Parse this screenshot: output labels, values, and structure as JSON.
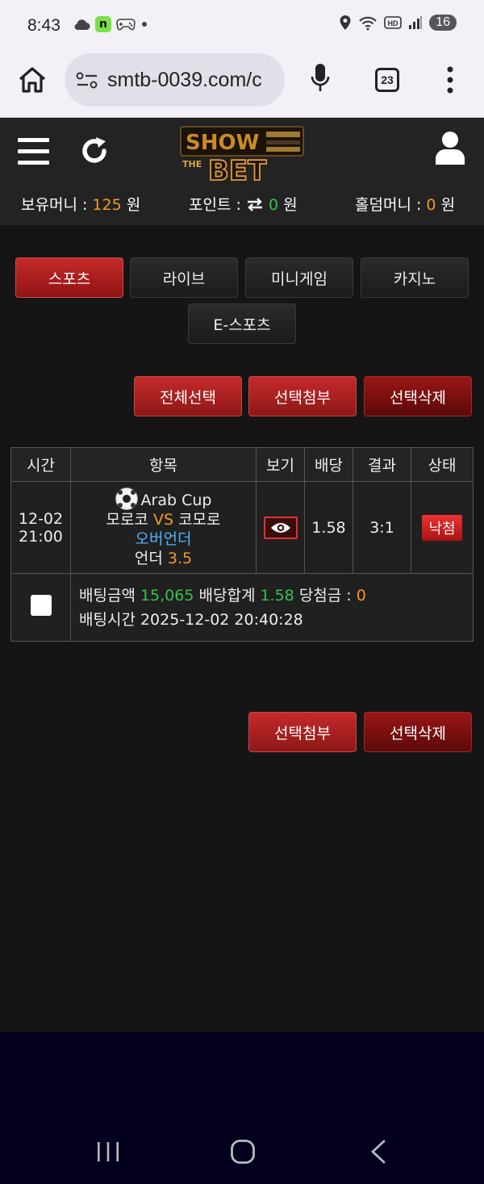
{
  "status_bar": {
    "time": "8:43",
    "notification_count": "16",
    "icons": [
      "cloud-icon",
      "n-app-icon",
      "gamepad-icon",
      "dot-icon",
      "location-icon",
      "wifi-icon",
      "hd-icon",
      "signal-icon"
    ]
  },
  "browser": {
    "url": "smtb-0039.com/c",
    "tab_count": "23"
  },
  "header": {
    "logo_top": "SHOW",
    "logo_mid": "THE",
    "logo_bottom": "BET"
  },
  "wallet": {
    "money_label": "보유머니 :",
    "money_value": "125",
    "money_unit": "원",
    "point_label": "포인트 :",
    "point_value": "0",
    "point_unit": "원",
    "hold_label": "홀덤머니 :",
    "hold_value": "0",
    "hold_unit": "원"
  },
  "tabs": [
    {
      "label": "스포츠",
      "active": true
    },
    {
      "label": "라이브",
      "active": false
    },
    {
      "label": "미니게임",
      "active": false
    },
    {
      "label": "카지노",
      "active": false
    },
    {
      "label": "E-스포츠",
      "active": false
    }
  ],
  "actions_top": {
    "select_all": "전체선택",
    "attach": "선택첨부",
    "delete": "선택삭제"
  },
  "table": {
    "headers": [
      "시간",
      "항목",
      "보기",
      "배당",
      "결과",
      "상태"
    ],
    "row": {
      "date": "12-02",
      "time": "21:00",
      "league": "Arab Cup",
      "home": "모로코",
      "vs": "VS",
      "away": "코모로",
      "market": "오버언더",
      "pick_label": "언더",
      "pick_line": "3.5",
      "odds": "1.58",
      "result": "3:1",
      "status": "낙첨"
    },
    "detail": {
      "bet_amount_label": "배팅금액",
      "bet_amount": "15,065",
      "odds_total_label": "배당합계",
      "odds_total": "1.58",
      "win_label": "당첨금 :",
      "win_amount": "0",
      "bet_time_label": "배팅시간",
      "bet_time": "2025-12-02 20:40:28"
    }
  },
  "actions_bottom": {
    "attach": "선택첨부",
    "delete": "선택삭제"
  },
  "colors": {
    "accent_red": "#c62a2a",
    "money_orange": "#f09a25",
    "positive_green": "#34c24a",
    "market_blue": "#4fb3ff"
  }
}
